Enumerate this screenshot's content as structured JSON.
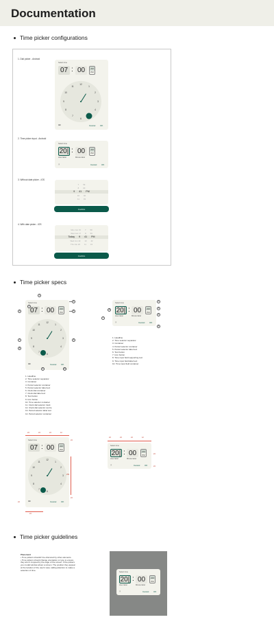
{
  "title": "Documentation",
  "sections": [
    "Time picker configurations",
    "Time picker specs",
    "Time picker guidelines"
  ],
  "configs": [
    "1. Dial picker - Android",
    "2. Time picker input - Android",
    "3. Without date picker - iOS",
    "4. With date picker - iOS"
  ],
  "picker": {
    "headline": "Select time",
    "hour": "07",
    "hour_input": "20|",
    "minute": "00",
    "sep": ":",
    "am": "AM",
    "pm": "PM",
    "hour_label": "Hour label",
    "minute_label": "Minute label",
    "cancel": "Cancel",
    "ok": "OK"
  },
  "dial": [
    "12",
    "1",
    "2",
    "3",
    "4",
    "5",
    "6",
    "7",
    "8",
    "9",
    "10",
    "11"
  ],
  "wheel": {
    "r1": [
      "7",
      "59"
    ],
    "r2": [
      "8",
      "00"
    ],
    "sel": [
      "9",
      "41",
      "PM"
    ],
    "r3": [
      "10",
      "02"
    ],
    "r4": [
      "11",
      "03"
    ],
    "confirm": "Confirm"
  },
  "dwheel": {
    "r1": [
      "Mon Jun 15",
      "7",
      "58"
    ],
    "r2": [
      "Wed Jun 17",
      "8",
      "59"
    ],
    "sel": [
      "Today",
      "9",
      "41",
      "PM"
    ],
    "r3": [
      "Wed Jun 19",
      "10",
      "42"
    ],
    "r4": [
      "Thu Jun 20",
      "11",
      "43"
    ]
  },
  "calls": [
    "0",
    "1",
    "2",
    "3",
    "4",
    "5",
    "6",
    "7",
    "8",
    "9",
    "10",
    "11",
    "12",
    "13",
    "14"
  ],
  "specdial": [
    "1. Headline",
    "2. Time selector separator",
    "3. Container",
    "4. Period selector container",
    "5. Period selector label text",
    "6. Clock dial container",
    "7. Clock dial label text",
    "8. Text button",
    "9. Icon button",
    "10. Time selector container",
    "11. Clock dial selector track",
    "12. Clock dial selector centre",
    "13. Period selector label text",
    "14. Period selector container"
  ],
  "specinput": [
    "1. Headline",
    "2. Time selector separator",
    "3. Container",
    "4. Period selector container",
    "5. Period selector label text",
    "6. Text button",
    "7. Icon button",
    "8. Time input field supporting text",
    "9. Time input field label text",
    "10. Time input field container"
  ],
  "meas": {
    "m24": "24",
    "m12": "12",
    "m256": "256"
  },
  "guide": {
    "title": "Placement",
    "p1": "• Time pickers shouldn't be obscured by other elements.",
    "p2": "• Time pickers should change orientation or type to ensure they aren't cropped by the edge of the screen. If the pickers you modal window about a screen. The position they appear at the location of the user's view, calling attention to make a selection of time."
  }
}
